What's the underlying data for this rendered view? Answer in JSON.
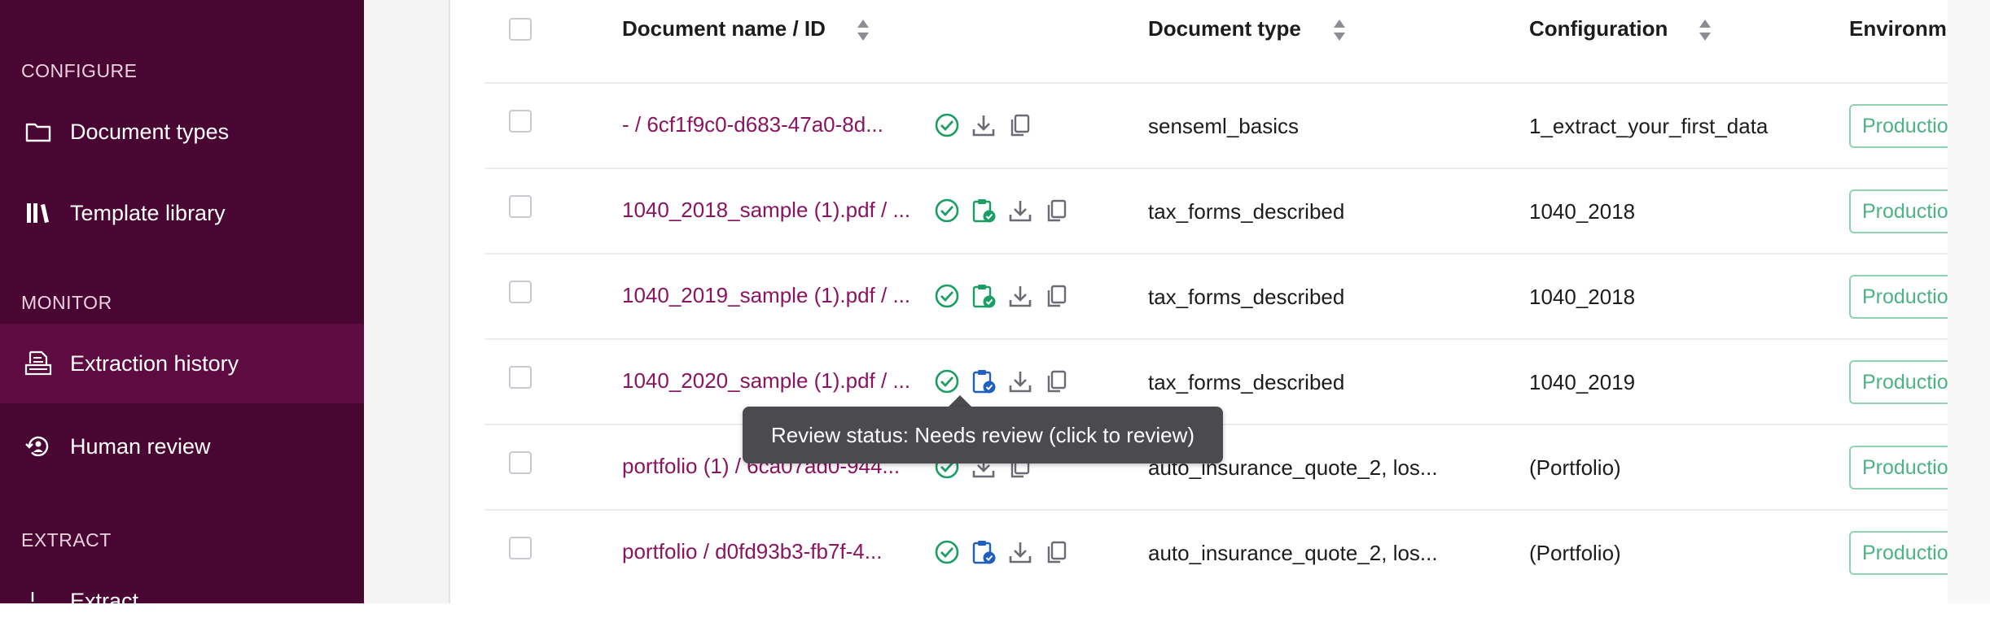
{
  "sidebar": {
    "sections": [
      {
        "label": "CONFIGURE"
      },
      {
        "label": "MONITOR"
      },
      {
        "label": "EXTRACT"
      }
    ],
    "items": [
      {
        "label": "Document types",
        "icon": "folder-icon"
      },
      {
        "label": "Template library",
        "icon": "library-icon"
      },
      {
        "label": "Extraction history",
        "icon": "history-document-icon",
        "active": true
      },
      {
        "label": "Human review",
        "icon": "human-review-icon"
      },
      {
        "label": "Extract",
        "icon": "extract-icon"
      }
    ]
  },
  "table": {
    "headers": {
      "name": "Document name / ID",
      "type": "Document type",
      "config": "Configuration",
      "env": "Environme"
    },
    "rows": [
      {
        "name": "- / 6cf1f9c0-d683-47a0-8d...",
        "type": "senseml_basics",
        "config": "1_extract_your_first_data",
        "env": "Production",
        "review": "none"
      },
      {
        "name": "1040_2018_sample (1).pdf / ...",
        "type": "tax_forms_described",
        "config": "1040_2018",
        "env": "Production",
        "review": "reviewed"
      },
      {
        "name": "1040_2019_sample (1).pdf / ...",
        "type": "tax_forms_described",
        "config": "1040_2018",
        "env": "Production",
        "review": "reviewed"
      },
      {
        "name": "1040_2020_sample (1).pdf / ...",
        "type": "tax_forms_described",
        "config": "1040_2019",
        "env": "Production",
        "review": "needs-review"
      },
      {
        "name": "portfolio (1) / 6ca07ad0-944...",
        "type": "auto_insurance_quote_2, los...",
        "config": "(Portfolio)",
        "env": "Production",
        "review": "none"
      },
      {
        "name": "portfolio / d0fd93b3-fb7f-4...",
        "type": "auto_insurance_quote_2, los...",
        "config": "(Portfolio)",
        "env": "Production",
        "review": "needs-review"
      }
    ]
  },
  "tooltip": {
    "text": "Review status: Needs review (click to review)"
  },
  "colors": {
    "sidebar_bg": "#4a0632",
    "sidebar_active": "#5e0b42",
    "link": "#8a1460",
    "success_green": "#1a9e63",
    "review_blue": "#1f5fbf",
    "env_border": "#8fd3b2"
  }
}
